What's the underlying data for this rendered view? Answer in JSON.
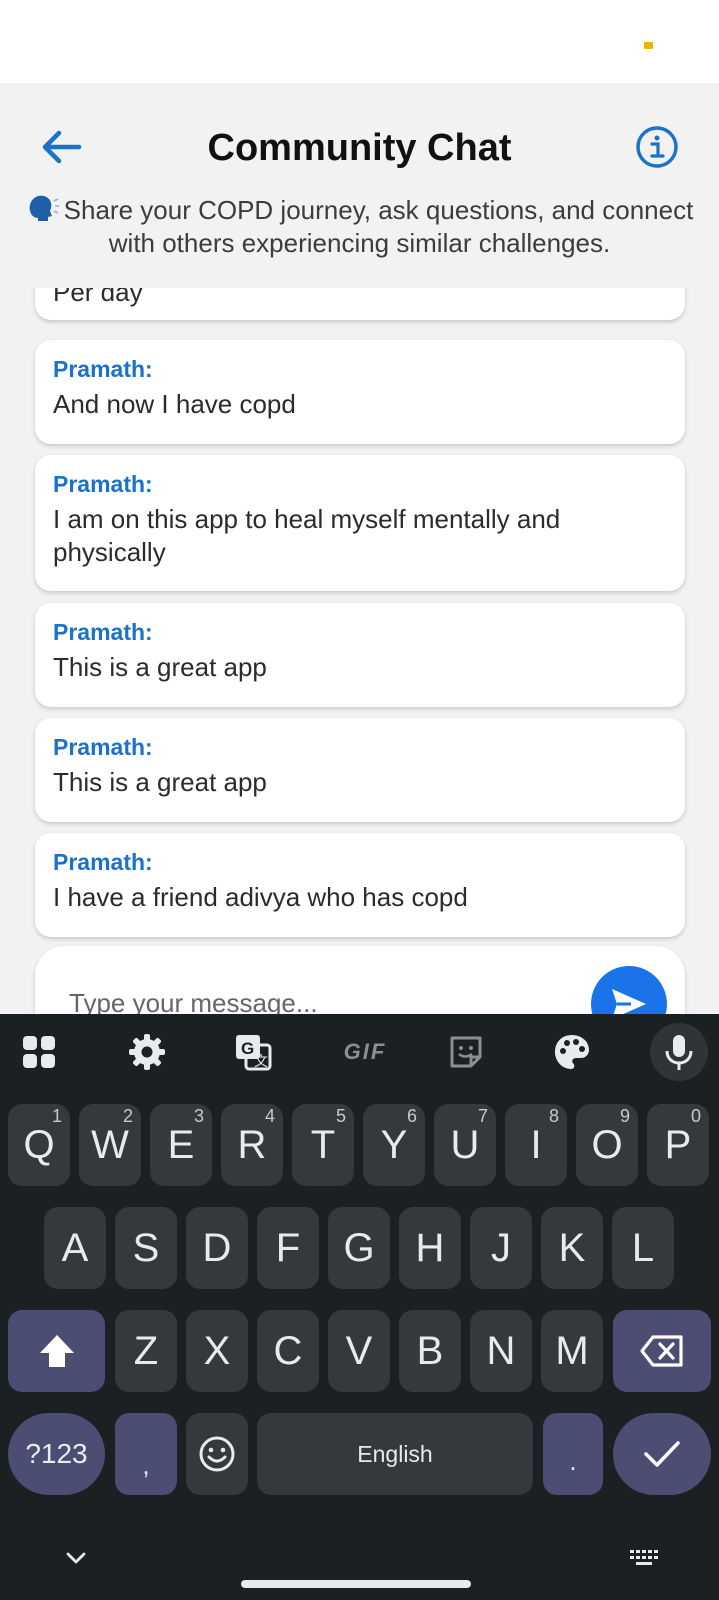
{
  "header": {
    "title": "Community Chat",
    "subtitle": "Share your COPD journey, ask questions, and connect with others experiencing similar challenges.",
    "back_icon": "arrow-left-icon",
    "info_icon": "info-circle-icon",
    "speaking_icon": "speaking-head-icon"
  },
  "messages": [
    {
      "name": "",
      "text": "Per day"
    },
    {
      "name": "Pramath:",
      "text": "And now I have copd"
    },
    {
      "name": "Pramath:",
      "text": "I am on this app to heal myself mentally and physically"
    },
    {
      "name": "Pramath:",
      "text": "This is a great app"
    },
    {
      "name": "Pramath:",
      "text": "This is a great app"
    },
    {
      "name": "Pramath:",
      "text": "I have a friend adivya who has copd"
    }
  ],
  "input": {
    "placeholder": "Type your message..."
  },
  "keyboard": {
    "row1": [
      {
        "key": "Q",
        "hint": "1"
      },
      {
        "key": "W",
        "hint": "2"
      },
      {
        "key": "E",
        "hint": "3"
      },
      {
        "key": "R",
        "hint": "4"
      },
      {
        "key": "T",
        "hint": "5"
      },
      {
        "key": "Y",
        "hint": "6"
      },
      {
        "key": "U",
        "hint": "7"
      },
      {
        "key": "I",
        "hint": "8"
      },
      {
        "key": "O",
        "hint": "9"
      },
      {
        "key": "P",
        "hint": "0"
      }
    ],
    "row2": [
      "A",
      "S",
      "D",
      "F",
      "G",
      "H",
      "J",
      "K",
      "L"
    ],
    "row3": [
      "Z",
      "X",
      "C",
      "V",
      "B",
      "N",
      "M"
    ],
    "symbols_label": "?123",
    "comma": ",",
    "period": ".",
    "space_label": "English",
    "toolbar": {
      "gif_label": "GIF"
    }
  },
  "colors": {
    "accent": "#1a73c8",
    "send_button": "#1a73e8",
    "keyboard_bg": "#1b2023",
    "key_bg": "#33393d",
    "modifier_key_bg": "#4b4d72"
  }
}
